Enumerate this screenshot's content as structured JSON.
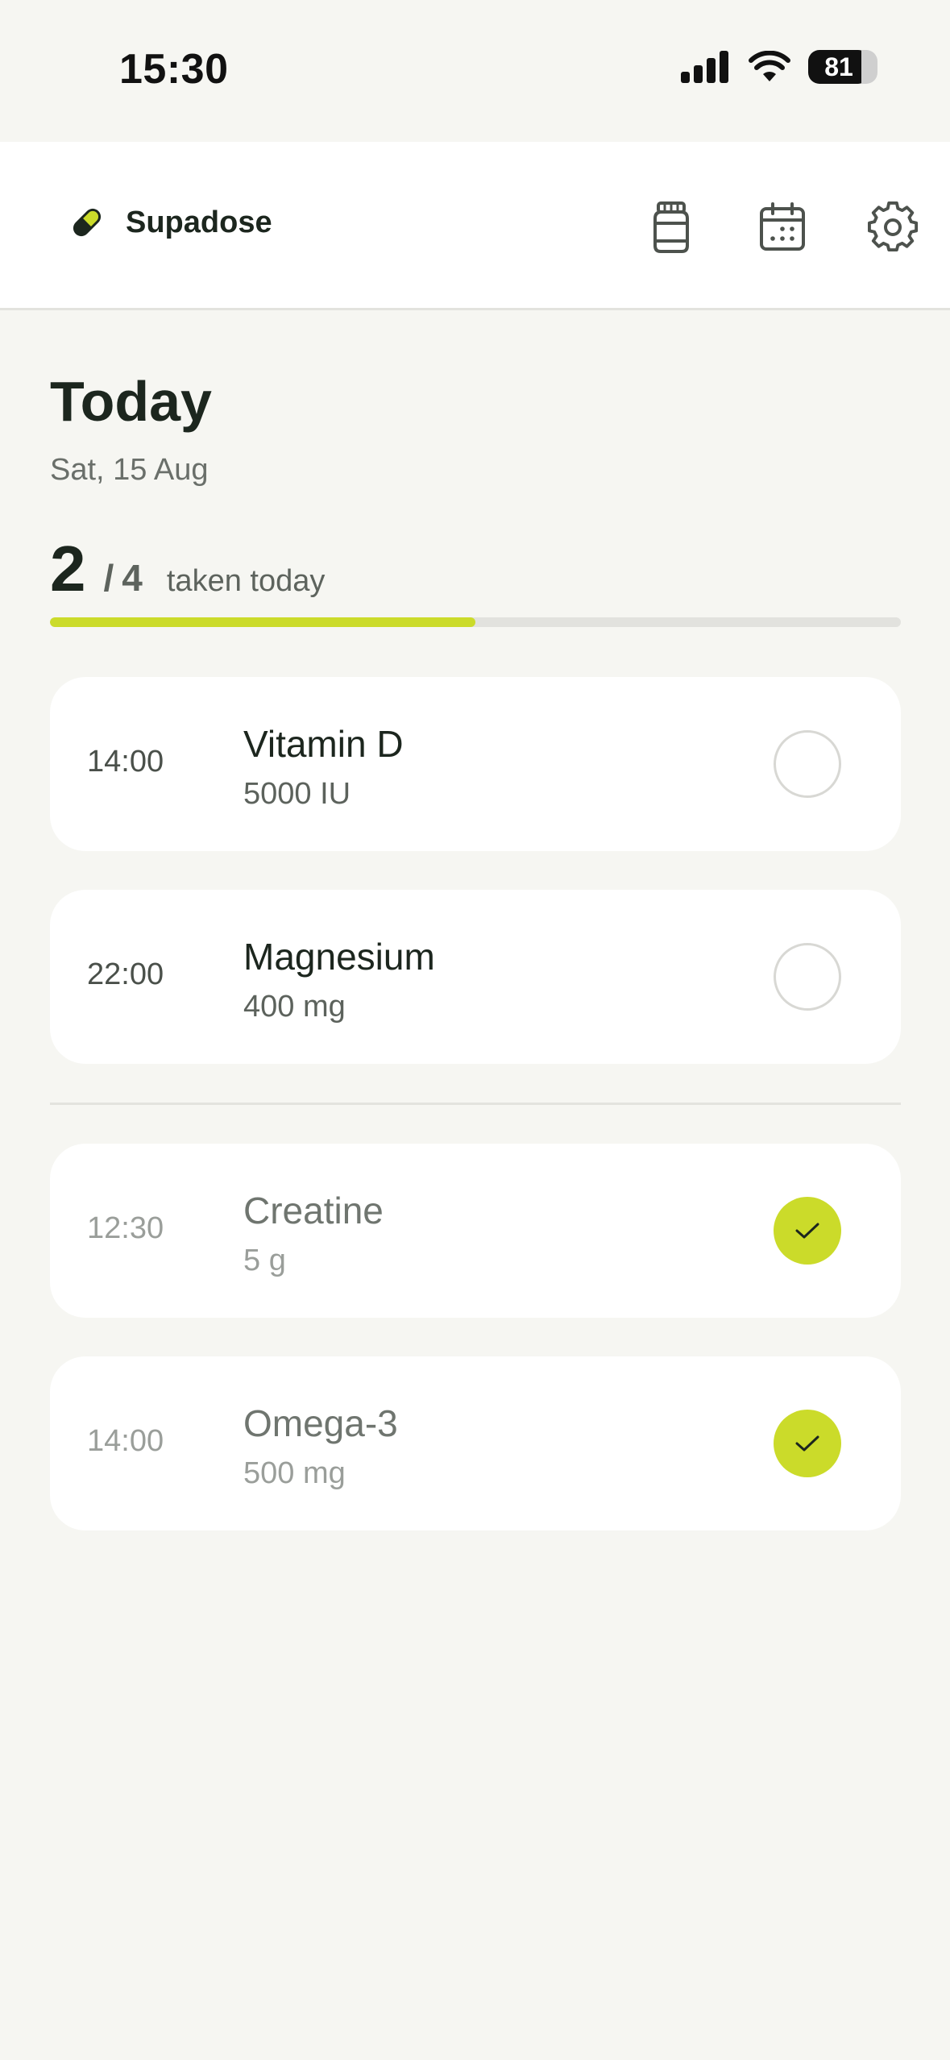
{
  "status_bar": {
    "time": "15:30",
    "battery": "81"
  },
  "app": {
    "name": "Supadose"
  },
  "header_icons": [
    "supplement-jar-icon",
    "calendar-icon",
    "gear-icon"
  ],
  "today": {
    "title": "Today",
    "date": "Sat, 15 Aug"
  },
  "progress": {
    "taken": "2",
    "separator": "/",
    "total": "4",
    "label": "taken today",
    "fraction": 0.5
  },
  "pending": [
    {
      "time": "14:00",
      "name": "Vitamin D",
      "dose": "5000 IU",
      "taken": false
    },
    {
      "time": "22:00",
      "name": "Magnesium",
      "dose": "400 mg",
      "taken": false
    }
  ],
  "completed": [
    {
      "time": "12:30",
      "name": "Creatine",
      "dose": "5 g",
      "taken": true
    },
    {
      "time": "14:00",
      "name": "Omega-3",
      "dose": "500 mg",
      "taken": true
    }
  ],
  "colors": {
    "accent": "#cbdb2a",
    "text": "#1c261e",
    "muted": "#6a6f6a",
    "background": "#f6f6f2"
  }
}
